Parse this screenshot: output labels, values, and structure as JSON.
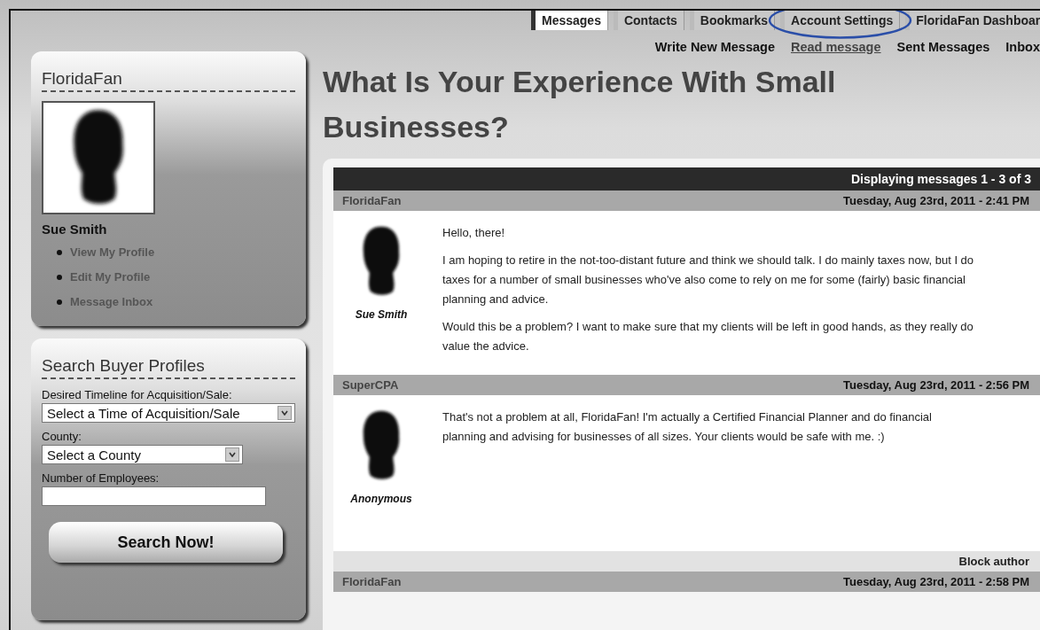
{
  "tabs": [
    {
      "label": "Messages",
      "selected": true,
      "circled": false
    },
    {
      "label": "Contacts",
      "selected": false,
      "circled": false
    },
    {
      "label": "Bookmarks",
      "selected": false,
      "circled": false
    },
    {
      "label": "Account Settings",
      "selected": false,
      "circled": true
    },
    {
      "label": "FloridaFan Dashboar",
      "selected": false,
      "circled": false
    }
  ],
  "subnav": [
    {
      "label": "Write New Message",
      "selected": false
    },
    {
      "label": "Read message",
      "selected": true
    },
    {
      "label": "Sent Messages",
      "selected": false
    },
    {
      "label": "Inbox",
      "selected": false
    }
  ],
  "profile": {
    "username": "FloridaFan",
    "name": "Sue Smith",
    "links": [
      "View My Profile",
      "Edit My Profile",
      "Message Inbox"
    ]
  },
  "search": {
    "title": "Search Buyer Profiles",
    "fields": [
      {
        "kind": "select",
        "label": "Desired Timeline for Acquisition/Sale:",
        "value": "Select a Time of Acquisition/Sale"
      },
      {
        "kind": "select",
        "label": "County:",
        "value": "Select a County"
      },
      {
        "kind": "text",
        "label": "Number of Employees:"
      }
    ],
    "button": "Search Now!"
  },
  "page_title": "What Is Your Experience With Small Businesses?",
  "messages_panel": {
    "summary": "Displaying messages 1 - 3 of 3",
    "messages": [
      {
        "sender": "FloridaFan",
        "date": "Tuesday, Aug 23rd, 2011 - 2:41 PM",
        "author_name": "Sue Smith",
        "paragraphs": [
          "Hello, there!",
          "I am hoping to retire in the not-too-distant future and think we should talk. I do mainly taxes now, but I do taxes for a number of small businesses who've also come to rely on me for some (fairly) basic financial planning and advice.",
          "Would this be a problem? I want to make sure that my clients will be left in good hands, as they really do value the advice."
        ]
      },
      {
        "sender": "SuperCPA",
        "date": "Tuesday, Aug 23rd, 2011 - 2:56 PM",
        "author_name": "Anonymous",
        "paragraphs": [
          "That's not a problem at all, FloridaFan! I'm actually a Certified Financial Planner and do financial planning and advising for businesses of all sizes. Your clients would be safe with me. :)"
        ],
        "footer_link": "Block author"
      },
      {
        "sender": "FloridaFan",
        "date": "Tuesday, Aug 23rd, 2011 - 2:58 PM"
      }
    ]
  }
}
